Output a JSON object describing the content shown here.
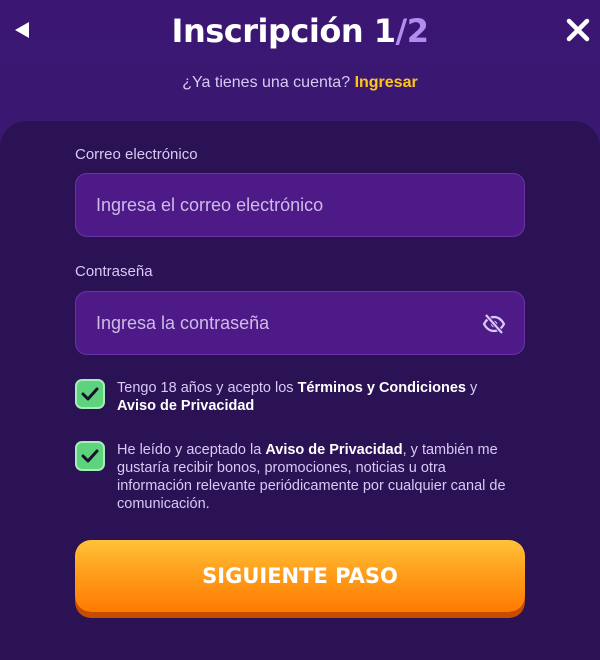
{
  "header": {
    "title_prefix": "Inscripción",
    "step_current": "1",
    "step_separator": "/",
    "step_total": "2",
    "back_icon": "back-arrow-icon",
    "close_icon": "close-icon"
  },
  "login": {
    "question": "¿Ya tienes una cuenta?",
    "link_label": "Ingresar"
  },
  "form": {
    "email": {
      "label": "Correo electrónico",
      "placeholder": "Ingresa el correo electrónico",
      "value": ""
    },
    "password": {
      "label": "Contraseña",
      "placeholder": "Ingresa la contraseña",
      "value": "",
      "toggle_icon": "eye-slash-icon"
    },
    "terms": {
      "checked": true,
      "text_before": "Tengo 18 años y acepto los ",
      "link_terms": "Términos y Condiciones",
      "text_and": " y",
      "link_privacy": "Aviso de Privacidad"
    },
    "marketing": {
      "checked": true,
      "text_before": "He leído y aceptado la ",
      "link_privacy": "Aviso de Privacidad",
      "text_after": ", y también me gustaría recibir bonos, promociones, noticias u otra información relevante periódicamente por cualquier canal de comunicación."
    },
    "submit_label": "SIGUIENTE PASO"
  },
  "colors": {
    "background": "#3a1870",
    "panel": "#2b1254",
    "field": "#4e1a87",
    "accent_yellow": "#ffc61a",
    "checkbox_green": "#5cd37c",
    "button_orange": "#ff9f1c"
  }
}
